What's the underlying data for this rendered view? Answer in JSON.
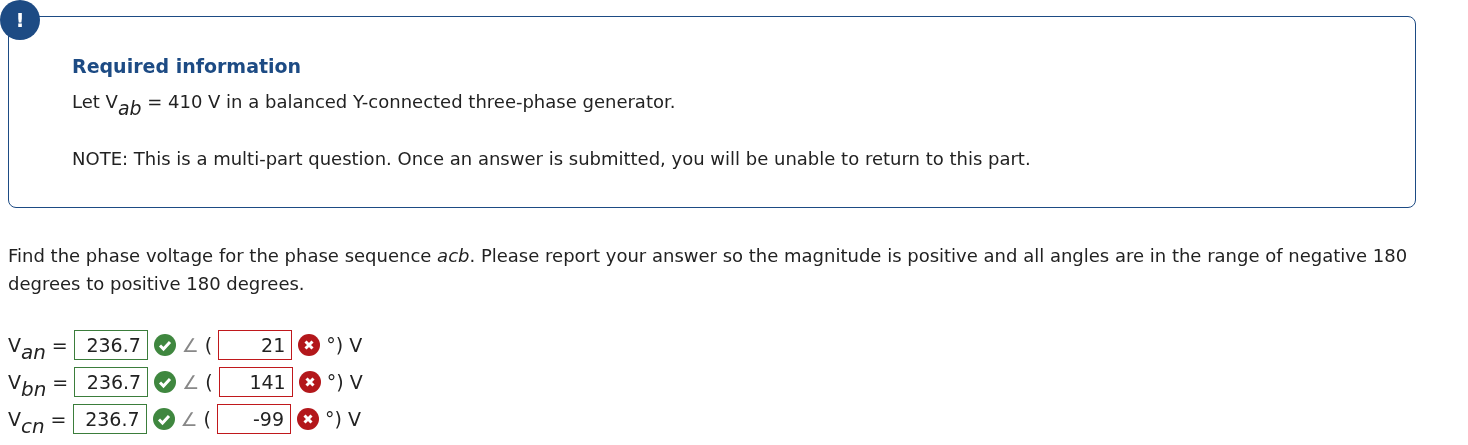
{
  "alert_badge": "!",
  "info_box": {
    "title": "Required information",
    "statement": "Let V$_{ab}$ = 410 V in a balanced Y-connected three-phase generator.",
    "note": "NOTE: This is a multi-part question. Once an answer is submitted, you will be unable to return to this part."
  },
  "question": "Find the phase voltage for the phase sequence *acb*. Please report your answer so the magnitude is positive and all angles are in the range of negative 180 degrees to positive 180 degrees.",
  "answers": [
    {
      "label": "V$_{an}$",
      "equals": "=",
      "magnitude": {
        "value": "236.7",
        "correct": true
      },
      "angle_sign": "∠",
      "open": "(",
      "angle": {
        "value": "21",
        "correct": false
      },
      "unit": "°) V"
    },
    {
      "label": "V$_{bn}$",
      "equals": "=",
      "magnitude": {
        "value": "236.7",
        "correct": true
      },
      "angle_sign": "∠",
      "open": "(",
      "angle": {
        "value": "141",
        "correct": false
      },
      "unit": "°) V"
    },
    {
      "label": "V$_{cn}$",
      "equals": "=",
      "magnitude": {
        "value": "236.7",
        "correct": true
      },
      "angle_sign": "∠",
      "open": "(",
      "angle": {
        "value": "-99",
        "correct": false
      },
      "unit": "°) V"
    }
  ]
}
